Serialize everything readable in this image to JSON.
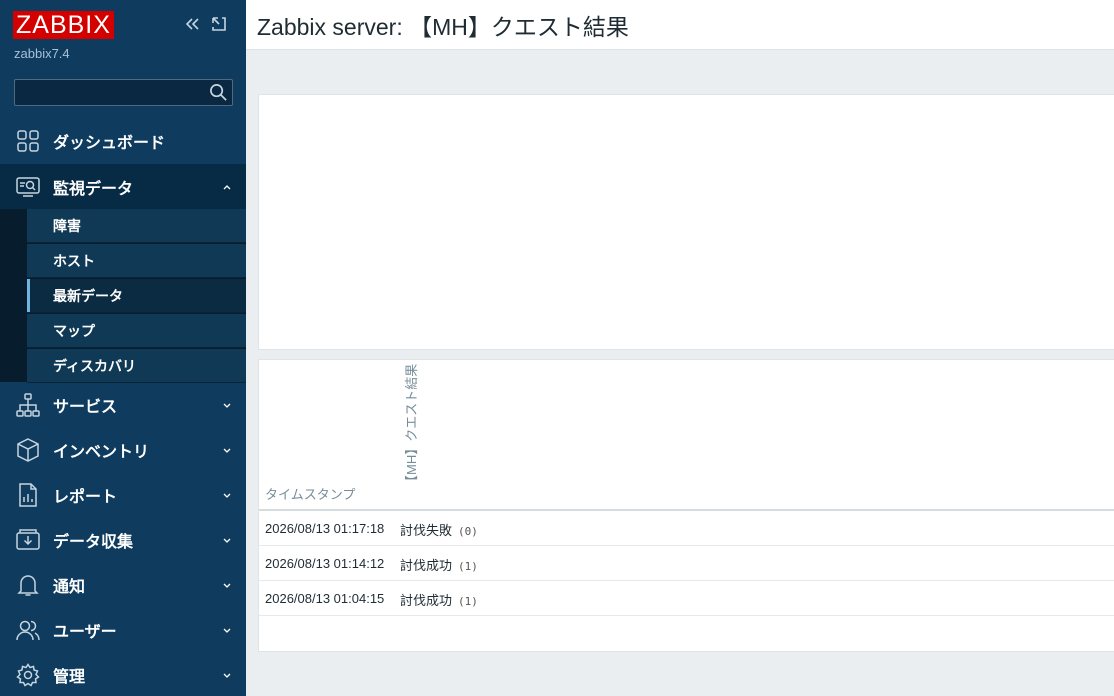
{
  "app": {
    "logo": "ZABBIX",
    "server_name": "zabbix7.4"
  },
  "search": {
    "value": "",
    "placeholder": ""
  },
  "menu": {
    "dashboard": "ダッシュボード",
    "monitoring": "監視データ",
    "services": "サービス",
    "inventory": "インベントリ",
    "reports": "レポート",
    "data_collection": "データ収集",
    "alerts": "通知",
    "users": "ユーザー",
    "administration": "管理"
  },
  "submenu": {
    "problems": "障害",
    "hosts": "ホスト",
    "latest_data": "最新データ",
    "maps": "マップ",
    "discovery": "ディスカバリ"
  },
  "header": {
    "title": "Zabbix server: 【MH】クエスト結果"
  },
  "table": {
    "col_timestamp": "タイムスタンプ",
    "col_value": "【MH】クエスト結果",
    "rows": [
      {
        "timestamp": "2026/08/13 01:17:18",
        "value": "討伐失敗",
        "code": "(0)"
      },
      {
        "timestamp": "2026/08/13 01:14:12",
        "value": "討伐成功",
        "code": "(1)"
      },
      {
        "timestamp": "2026/08/13 01:04:15",
        "value": "討伐成功",
        "code": "(1)"
      }
    ]
  },
  "colors": {
    "sidebar_bg": "#0e3b5e",
    "logo_bg": "#d40000",
    "selected_accent": "#6fb5e2"
  }
}
